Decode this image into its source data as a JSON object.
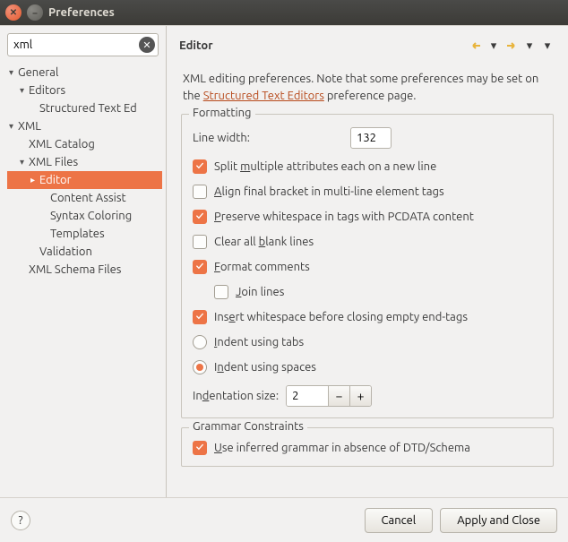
{
  "window": {
    "title": "Preferences"
  },
  "search": {
    "value": "xml"
  },
  "tree": [
    {
      "label": "General",
      "indent": 0,
      "expanded": true
    },
    {
      "label": "Editors",
      "indent": 1,
      "expanded": true
    },
    {
      "label": "Structured Text Ed",
      "indent": 2,
      "expanded": false,
      "leaf": true
    },
    {
      "label": "XML",
      "indent": 0,
      "expanded": true
    },
    {
      "label": "XML Catalog",
      "indent": 1,
      "leaf": true
    },
    {
      "label": "XML Files",
      "indent": 1,
      "expanded": true
    },
    {
      "label": "Editor",
      "indent": 2,
      "expanded": false,
      "selected": true
    },
    {
      "label": "Content Assist",
      "indent": 3,
      "leaf": true
    },
    {
      "label": "Syntax Coloring",
      "indent": 3,
      "leaf": true
    },
    {
      "label": "Templates",
      "indent": 3,
      "leaf": true
    },
    {
      "label": "Validation",
      "indent": 2,
      "leaf": true
    },
    {
      "label": "XML Schema Files",
      "indent": 1,
      "leaf": true
    }
  ],
  "page": {
    "title": "Editor",
    "desc1": "XML editing preferences.  Note that some preferences may be set on the ",
    "link": "Structured Text Editors",
    "desc2": " preference page."
  },
  "formatting": {
    "legend": "Formatting",
    "line_width_label": "Line width:",
    "line_width_value": "132",
    "split_label_pre": "Split ",
    "split_label_ul": "m",
    "split_label_post": "ultiple attributes each on a new line",
    "align_pre": "",
    "align_ul": "A",
    "align_post": "lign final bracket in multi-line element tags",
    "preserve_pre": "",
    "preserve_ul": "P",
    "preserve_post": "reserve whitespace in tags with PCDATA content",
    "clear_pre": "Clear all ",
    "clear_ul": "b",
    "clear_post": "lank lines",
    "fmtc_pre": "",
    "fmtc_ul": "F",
    "fmtc_post": "ormat comments",
    "join_pre": "",
    "join_ul": "J",
    "join_post": "oin lines",
    "insert_pre": "Ins",
    "insert_ul": "e",
    "insert_post": "rt whitespace before closing empty end-tags",
    "tabs_pre": "",
    "tabs_ul": "I",
    "tabs_post": "ndent using tabs",
    "spaces_pre": "I",
    "spaces_ul": "n",
    "spaces_post": "dent using spaces",
    "indent_size_pre": "In",
    "indent_size_ul": "d",
    "indent_size_post": "entation size:",
    "indent_size_value": "2",
    "checks": {
      "split": true,
      "align": false,
      "preserve": true,
      "clear": false,
      "fmtc": true,
      "join": false,
      "insert": true
    },
    "indent_mode": "spaces"
  },
  "grammar": {
    "legend": "Grammar Constraints",
    "use_pre": "",
    "use_ul": "U",
    "use_post": "se inferred grammar in absence of DTD/Schema",
    "checked": true
  },
  "footer": {
    "cancel": "Cancel",
    "apply": "Apply and Close"
  }
}
